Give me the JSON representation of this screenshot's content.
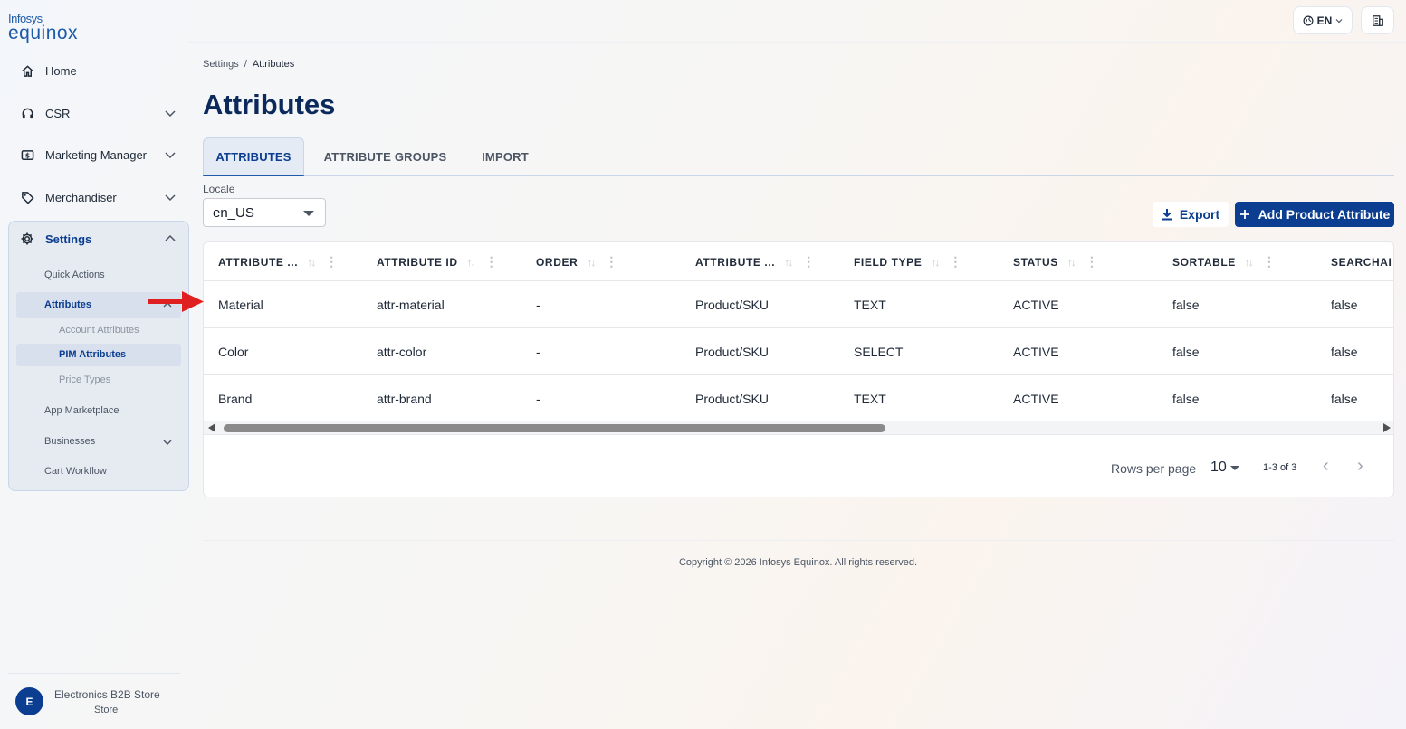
{
  "brand": {
    "line1": "Infosys",
    "line2": "equinox"
  },
  "nav": {
    "home": "Home",
    "csr": "CSR",
    "marketing": "Marketing Manager",
    "merchandiser": "Merchandiser",
    "settings": "Settings",
    "settings_sub": {
      "quick_actions": "Quick Actions",
      "attributes": "Attributes",
      "account_attributes": "Account Attributes",
      "pim_attributes": "PIM Attributes",
      "price_types": "Price Types",
      "app_marketplace": "App Marketplace",
      "businesses": "Businesses",
      "cart_workflow": "Cart Workflow"
    }
  },
  "store": {
    "initial": "E",
    "name": "Electronics B2B Store",
    "type": "Store"
  },
  "topbar": {
    "language": "EN"
  },
  "breadcrumb": {
    "parent": "Settings",
    "sep": "/",
    "current": "Attributes"
  },
  "page": {
    "title": "Attributes"
  },
  "tabs": [
    "ATTRIBUTES",
    "ATTRIBUTE GROUPS",
    "IMPORT"
  ],
  "locale": {
    "label": "Locale",
    "value": "en_US"
  },
  "actions": {
    "export": "Export",
    "add": "Add Product Attribute"
  },
  "table": {
    "columns": [
      "ATTRIBUTE ...",
      "ATTRIBUTE ID",
      "ORDER",
      "ATTRIBUTE ...",
      "FIELD TYPE",
      "STATUS",
      "SORTABLE",
      "SEARCHAI"
    ],
    "rows": [
      [
        "Material",
        "attr-material",
        "-",
        "Product/SKU",
        "TEXT",
        "ACTIVE",
        "false",
        "false"
      ],
      [
        "Color",
        "attr-color",
        "-",
        "Product/SKU",
        "SELECT",
        "ACTIVE",
        "false",
        "false"
      ],
      [
        "Brand",
        "attr-brand",
        "-",
        "Product/SKU",
        "TEXT",
        "ACTIVE",
        "false",
        "false"
      ]
    ]
  },
  "pagination": {
    "rows_label": "Rows per page",
    "rows_value": "10",
    "range": "1-3 of 3"
  },
  "footer": {
    "copyright": "Copyright © 2026 Infosys Equinox. All rights reserved."
  },
  "colors": {
    "primary": "#0b3d91",
    "annotation_arrow": "#e02020"
  }
}
